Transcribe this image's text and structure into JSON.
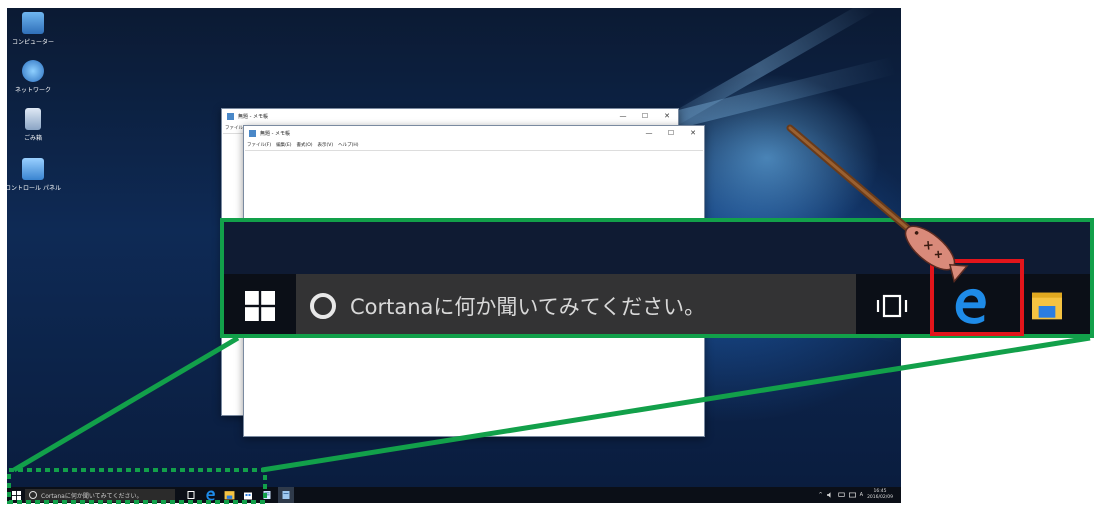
{
  "desktop": {
    "icons": [
      {
        "label": "コンピューター",
        "icon": "computer-icon"
      },
      {
        "label": "ネットワーク",
        "icon": "network-icon"
      },
      {
        "label": "ごみ箱",
        "icon": "recycle-bin-icon"
      },
      {
        "label": "コントロール パネル",
        "icon": "control-panel-icon"
      }
    ]
  },
  "notepad_back": {
    "title": "無題 - メモ帳",
    "menu_partial": "ファイル"
  },
  "notepad_front": {
    "title": "無題 - メモ帳",
    "menus": [
      "ファイル(F)",
      "編集(E)",
      "書式(O)",
      "表示(V)",
      "ヘルプ(H)"
    ],
    "minimize": "—",
    "maximize": "☐",
    "close": "✕"
  },
  "taskbar": {
    "search_placeholder": "Cortanaに何か聞いてみてください。",
    "tray": {
      "ime": "A",
      "time": "16:45",
      "date": "2016/02/09"
    }
  },
  "zoom_callout": {
    "search_placeholder": "Cortanaに何か聞いてみてください。",
    "highlighted_app": "edge-icon"
  },
  "colors": {
    "callout_border": "#12a04a",
    "highlight_border": "#e3151b",
    "edge_blue": "#1e8be8",
    "explorer_yellow": "#f5c342"
  }
}
